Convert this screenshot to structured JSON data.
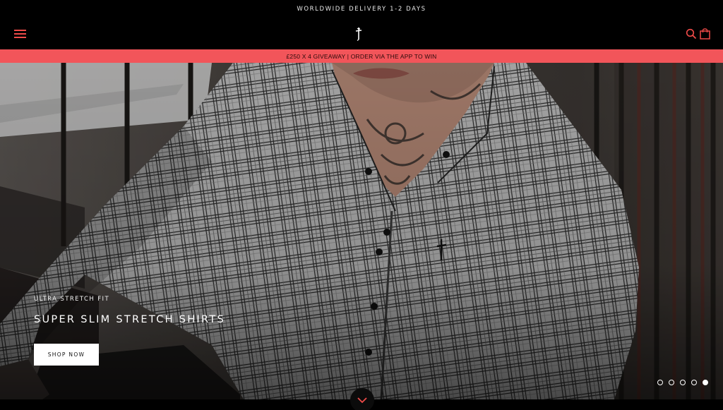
{
  "announcement": {
    "text": "WORLDWIDE DELIVERY 1-2 DAYS"
  },
  "header": {
    "menu_icon": "hamburger-menu-icon",
    "logo_icon": "brand-dagger-logo",
    "search_icon": "search-icon",
    "cart_icon": "shopping-bag-icon"
  },
  "promo": {
    "text": "£250 X 4 GIVEAWAY | ORDER VIA THE APP TO WIN"
  },
  "hero": {
    "eyebrow": "ULTRA STRETCH FIT",
    "title": "SUPER SLIM STRETCH SHIRTS",
    "cta_label": "SHOP NOW",
    "slides": 5,
    "active_slide": 5,
    "scroll_icon": "chevron-down-icon"
  },
  "colors": {
    "background": "#000000",
    "accent": "#F04B49",
    "promo_bar": "#F2555A",
    "text": "#FFFFFF"
  }
}
